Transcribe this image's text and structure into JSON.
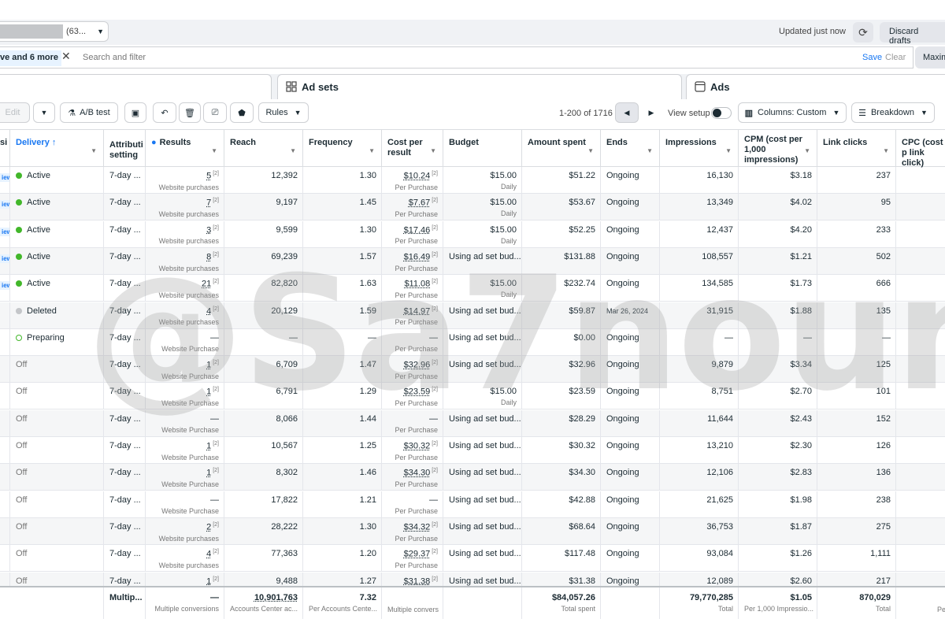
{
  "topbar": {
    "account_suffix": "(63...",
    "updated": "Updated just now",
    "discard": "Discard drafts"
  },
  "filter": {
    "chip": "ve and 6 more",
    "placeholder": "Search and filter",
    "save": "Save",
    "clear": "Clear",
    "maxi": "Maxim"
  },
  "tabs": {
    "adsets": "Ad sets",
    "ads": "Ads"
  },
  "toolbar": {
    "edit": "Edit",
    "ab_test": "A/B test",
    "rules": "Rules",
    "pager": "1-200 of 1716",
    "view_setup": "View setup",
    "columns": "Columns: Custom",
    "breakdown": "Breakdown"
  },
  "headers": {
    "col0": "si",
    "delivery": "Delivery",
    "attribution": "Attributi setting",
    "results": "Results",
    "reach": "Reach",
    "frequency": "Frequency",
    "cpr": "Cost per result",
    "budget": "Budget",
    "spent": "Amount spent",
    "ends": "Ends",
    "impressions": "Impressions",
    "cpm": "CPM (cost per 1,000 impressions)",
    "clicks": "Link clicks",
    "cpc": "CPC (cost p link click)"
  },
  "rows": [
    {
      "pill": "iew",
      "delivery": "Active",
      "status": "green",
      "attr": "7-day ...",
      "results": "5",
      "results_sub": "Website purchases",
      "reach": "12,392",
      "freq": "1.30",
      "cpr": "$10.24",
      "cpr_sub": "Per Purchase",
      "budget": "$15.00",
      "budget_sub": "Daily",
      "spent": "$51.22",
      "ends": "Ongoing",
      "impr": "16,130",
      "cpm": "$3.18",
      "clicks": "237"
    },
    {
      "pill": "iew",
      "delivery": "Active",
      "status": "green",
      "attr": "7-day ...",
      "results": "7",
      "results_sub": "Website purchases",
      "reach": "9,197",
      "freq": "1.45",
      "cpr": "$7.67",
      "cpr_sub": "Per Purchase",
      "budget": "$15.00",
      "budget_sub": "Daily",
      "spent": "$53.67",
      "ends": "Ongoing",
      "impr": "13,349",
      "cpm": "$4.02",
      "clicks": "95"
    },
    {
      "pill": "iew",
      "delivery": "Active",
      "status": "green",
      "attr": "7-day ...",
      "results": "3",
      "results_sub": "Website purchases",
      "reach": "9,599",
      "freq": "1.30",
      "cpr": "$17.46",
      "cpr_sub": "Per Purchase",
      "budget": "$15.00",
      "budget_sub": "Daily",
      "spent": "$52.25",
      "ends": "Ongoing",
      "impr": "12,437",
      "cpm": "$4.20",
      "clicks": "233"
    },
    {
      "pill": "iew",
      "delivery": "Active",
      "status": "green",
      "attr": "7-day ...",
      "results": "8",
      "results_sub": "Website purchases",
      "reach": "69,239",
      "freq": "1.57",
      "cpr": "$16.49",
      "cpr_sub": "Per Purchase",
      "budget": "Using ad set bud...",
      "budget_sub": "",
      "spent": "$131.88",
      "ends": "Ongoing",
      "impr": "108,557",
      "cpm": "$1.21",
      "clicks": "502"
    },
    {
      "pill": "iew",
      "delivery": "Active",
      "status": "green",
      "attr": "7-day ...",
      "results": "21",
      "results_sub": "Website purchases",
      "reach": "82,820",
      "freq": "1.63",
      "cpr": "$11.08",
      "cpr_sub": "Per Purchase",
      "budget": "$15.00",
      "budget_sub": "Daily",
      "spent": "$232.74",
      "ends": "Ongoing",
      "impr": "134,585",
      "cpm": "$1.73",
      "clicks": "666"
    },
    {
      "pill": "",
      "delivery": "Deleted",
      "status": "grey",
      "attr": "7-day ...",
      "results": "4",
      "results_sub": "Website purchases",
      "reach": "20,129",
      "freq": "1.59",
      "cpr": "$14.97",
      "cpr_sub": "Per Purchase",
      "budget": "Using ad set bud...",
      "budget_sub": "",
      "spent": "$59.87",
      "ends": "Mar 26, 2024",
      "impr": "31,915",
      "cpm": "$1.88",
      "clicks": "135"
    },
    {
      "pill": "",
      "delivery": "Preparing",
      "status": "ring",
      "attr": "7-day ...",
      "results": "—",
      "results_sub": "Website Purchase",
      "reach": "—",
      "freq": "—",
      "cpr": "—",
      "cpr_sub": "Per Purchase",
      "budget": "Using ad set bud...",
      "budget_sub": "",
      "spent": "$0.00",
      "ends": "Ongoing",
      "impr": "—",
      "cpm": "—",
      "clicks": "—"
    },
    {
      "pill": "",
      "delivery": "Off",
      "status": "off",
      "attr": "7-day ...",
      "results": "1",
      "results_sub": "Website Purchase",
      "reach": "6,709",
      "freq": "1.47",
      "cpr": "$32.96",
      "cpr_sub": "Per Purchase",
      "budget": "Using ad set bud...",
      "budget_sub": "",
      "spent": "$32.96",
      "ends": "Ongoing",
      "impr": "9,879",
      "cpm": "$3.34",
      "clicks": "125"
    },
    {
      "pill": "",
      "delivery": "Off",
      "status": "off",
      "attr": "7-day ...",
      "results": "1",
      "results_sub": "Website Purchase",
      "reach": "6,791",
      "freq": "1.29",
      "cpr": "$23.59",
      "cpr_sub": "Per Purchase",
      "budget": "$15.00",
      "budget_sub": "Daily",
      "spent": "$23.59",
      "ends": "Ongoing",
      "impr": "8,751",
      "cpm": "$2.70",
      "clicks": "101"
    },
    {
      "pill": "",
      "delivery": "Off",
      "status": "off",
      "attr": "7-day ...",
      "results": "—",
      "results_sub": "Website Purchase",
      "reach": "8,066",
      "freq": "1.44",
      "cpr": "—",
      "cpr_sub": "Per Purchase",
      "budget": "Using ad set bud...",
      "budget_sub": "",
      "spent": "$28.29",
      "ends": "Ongoing",
      "impr": "11,644",
      "cpm": "$2.43",
      "clicks": "152"
    },
    {
      "pill": "",
      "delivery": "Off",
      "status": "off",
      "attr": "7-day ...",
      "results": "1",
      "results_sub": "Website Purchase",
      "reach": "10,567",
      "freq": "1.25",
      "cpr": "$30.32",
      "cpr_sub": "Per Purchase",
      "budget": "Using ad set bud...",
      "budget_sub": "",
      "spent": "$30.32",
      "ends": "Ongoing",
      "impr": "13,210",
      "cpm": "$2.30",
      "clicks": "126"
    },
    {
      "pill": "",
      "delivery": "Off",
      "status": "off",
      "attr": "7-day ...",
      "results": "1",
      "results_sub": "Website Purchase",
      "reach": "8,302",
      "freq": "1.46",
      "cpr": "$34.30",
      "cpr_sub": "Per Purchase",
      "budget": "Using ad set bud...",
      "budget_sub": "",
      "spent": "$34.30",
      "ends": "Ongoing",
      "impr": "12,106",
      "cpm": "$2.83",
      "clicks": "136"
    },
    {
      "pill": "",
      "delivery": "Off",
      "status": "off",
      "attr": "7-day ...",
      "results": "—",
      "results_sub": "Website Purchase",
      "reach": "17,822",
      "freq": "1.21",
      "cpr": "—",
      "cpr_sub": "Per Purchase",
      "budget": "Using ad set bud...",
      "budget_sub": "",
      "spent": "$42.88",
      "ends": "Ongoing",
      "impr": "21,625",
      "cpm": "$1.98",
      "clicks": "238"
    },
    {
      "pill": "",
      "delivery": "Off",
      "status": "off",
      "attr": "7-day ...",
      "results": "2",
      "results_sub": "Website purchases",
      "reach": "28,222",
      "freq": "1.30",
      "cpr": "$34.32",
      "cpr_sub": "Per Purchase",
      "budget": "Using ad set bud...",
      "budget_sub": "",
      "spent": "$68.64",
      "ends": "Ongoing",
      "impr": "36,753",
      "cpm": "$1.87",
      "clicks": "275"
    },
    {
      "pill": "",
      "delivery": "Off",
      "status": "off",
      "attr": "7-day ...",
      "results": "4",
      "results_sub": "Website purchases",
      "reach": "77,363",
      "freq": "1.20",
      "cpr": "$29.37",
      "cpr_sub": "Per Purchase",
      "budget": "Using ad set bud...",
      "budget_sub": "",
      "spent": "$117.48",
      "ends": "Ongoing",
      "impr": "93,084",
      "cpm": "$1.26",
      "clicks": "1,111"
    },
    {
      "pill": "",
      "delivery": "Off",
      "status": "off",
      "attr": "7-day ...",
      "results": "1",
      "results_sub": "",
      "reach": "9,488",
      "freq": "1.27",
      "cpr": "$31.38",
      "cpr_sub": "",
      "budget": "Using ad set bud...",
      "budget_sub": "",
      "spent": "$31.38",
      "ends": "Ongoing",
      "impr": "12,089",
      "cpm": "$2.60",
      "clicks": "217"
    }
  ],
  "totals": {
    "attr": "Multip...",
    "results": "—",
    "results_sub": "Multiple conversions",
    "reach": "10,901,763",
    "reach_sub": "Accounts Center ac...",
    "freq": "7.32",
    "freq_sub": "Per Accounts Cente...",
    "cpr_sub": "Multiple convers",
    "spent": "$84,057.26",
    "spent_sub": "Total spent",
    "impr": "79,770,285",
    "impr_sub": "Total",
    "cpm": "$1.05",
    "cpm_sub": "Per 1,000 Impressio...",
    "clicks": "870,029",
    "clicks_sub": "Total",
    "cpc_sub": "Pe"
  },
  "watermark": "@Sa7noun"
}
